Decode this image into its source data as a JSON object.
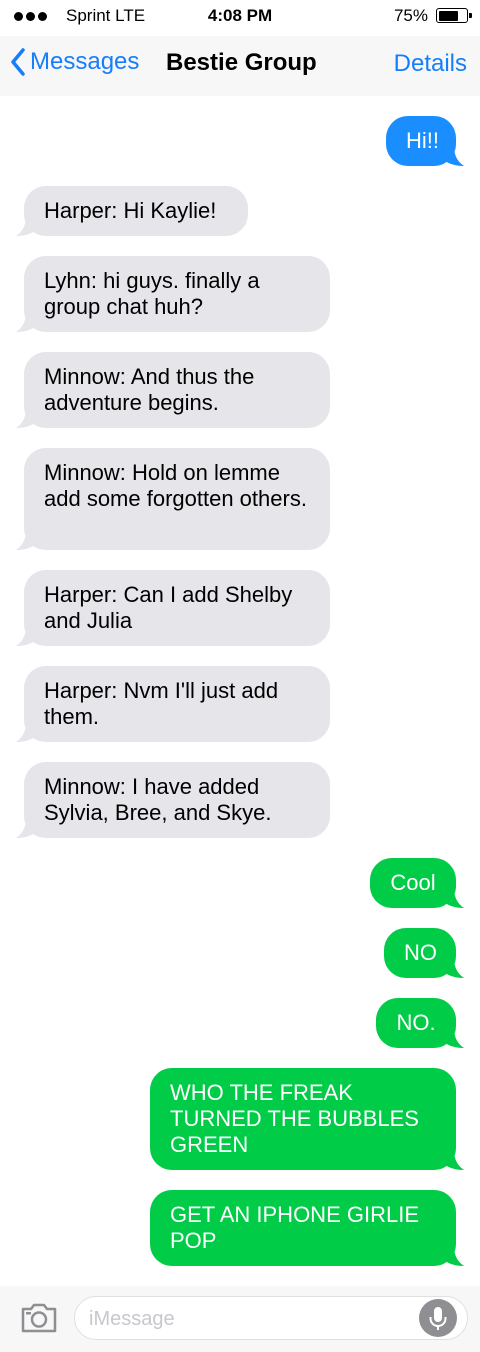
{
  "status_bar": {
    "carrier": "Sprint  LTE",
    "time": "4:08 PM",
    "battery_percent": "75%",
    "battery_level": 0.75
  },
  "nav_bar": {
    "back_label": "Messages",
    "title": "Bestie Group",
    "details_label": "Details"
  },
  "colors": {
    "imessage_blue": "#1a8dff",
    "sms_green": "#00cc47",
    "incoming_gray": "#e5e5ea",
    "link_blue": "#157efb"
  },
  "messages": [
    {
      "direction": "outgoing",
      "color": "blue",
      "text": "Hi!!"
    },
    {
      "direction": "incoming",
      "text": "Harper: Hi Kaylie!"
    },
    {
      "direction": "incoming",
      "text": "Lyhn: hi guys. finally a group chat huh?"
    },
    {
      "direction": "incoming",
      "text": "Minnow: And thus the adventure begins."
    },
    {
      "direction": "incoming",
      "text": "Minnow: Hold on lemme add some forgotten others."
    },
    {
      "direction": "incoming",
      "text": "Harper: Can I add Shelby and Julia"
    },
    {
      "direction": "incoming",
      "text": "Harper: Nvm I'll just add them."
    },
    {
      "direction": "incoming",
      "text": "Minnow: I have added Sylvia, Bree, and Skye."
    },
    {
      "direction": "outgoing",
      "color": "green",
      "text": "Cool"
    },
    {
      "direction": "outgoing",
      "color": "green",
      "text": "NO"
    },
    {
      "direction": "outgoing",
      "color": "green",
      "text": "NO."
    },
    {
      "direction": "outgoing",
      "color": "green",
      "text": "WHO THE FREAK TURNED THE BUBBLES GREEN"
    },
    {
      "direction": "outgoing",
      "color": "green",
      "text": "GET AN IPHONE GIRLIE POP"
    }
  ],
  "input_bar": {
    "placeholder": "iMessage",
    "camera_icon": "camera-icon",
    "mic_icon": "microphone-icon"
  }
}
